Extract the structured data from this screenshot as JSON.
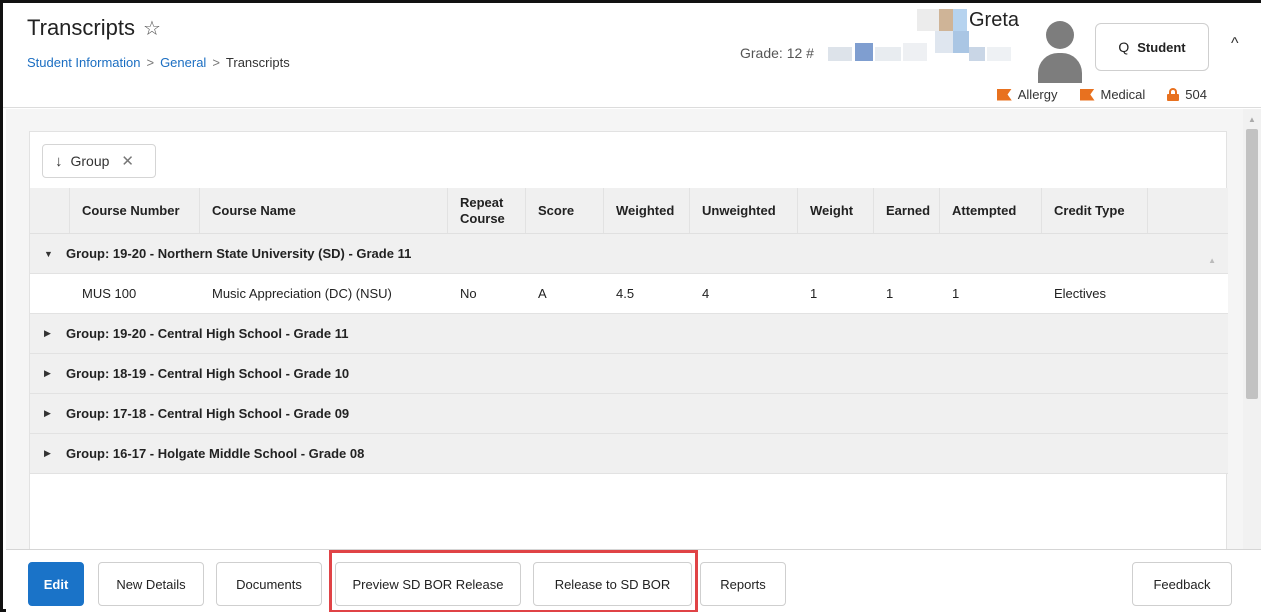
{
  "header": {
    "title": "Transcripts",
    "breadcrumb": [
      "Student Information",
      "General",
      "Transcripts"
    ],
    "grade_label": "Grade: 12 #",
    "student_name": "Greta",
    "student_button": "Student",
    "flags": [
      "Allergy",
      "Medical",
      "504"
    ]
  },
  "grouping": {
    "chip_label": "Group"
  },
  "table": {
    "columns": [
      "Course Number",
      "Course Name",
      "Repeat Course",
      "Score",
      "Weighted",
      "Unweighted",
      "Weight",
      "Earned",
      "Attempted",
      "Credit Type"
    ],
    "groups": [
      {
        "label": "Group: 19-20 - Northern State University (SD) - Grade 11",
        "expanded": true,
        "rows": [
          [
            "MUS 100",
            "Music Appreciation (DC) (NSU)",
            "No",
            "A",
            "4.5",
            "4",
            "1",
            "1",
            "1",
            "Electives"
          ]
        ]
      },
      {
        "label": "Group: 19-20 - Central High School - Grade 11",
        "expanded": false,
        "rows": []
      },
      {
        "label": "Group: 18-19 - Central High School - Grade 10",
        "expanded": false,
        "rows": []
      },
      {
        "label": "Group: 17-18 - Central High School - Grade 09",
        "expanded": false,
        "rows": []
      },
      {
        "label": "Group: 16-17 - Holgate Middle School - Grade 08",
        "expanded": false,
        "rows": []
      }
    ]
  },
  "toolbar": {
    "edit": "Edit",
    "new_details": "New Details",
    "documents": "Documents",
    "preview_release": "Preview SD BOR Release",
    "release": "Release to SD BOR",
    "reports": "Reports",
    "feedback": "Feedback"
  },
  "colors": {
    "accent": "#1a73c8",
    "flag": "#e8711f",
    "highlight": "#e04346",
    "link": "#1b6ec2"
  }
}
